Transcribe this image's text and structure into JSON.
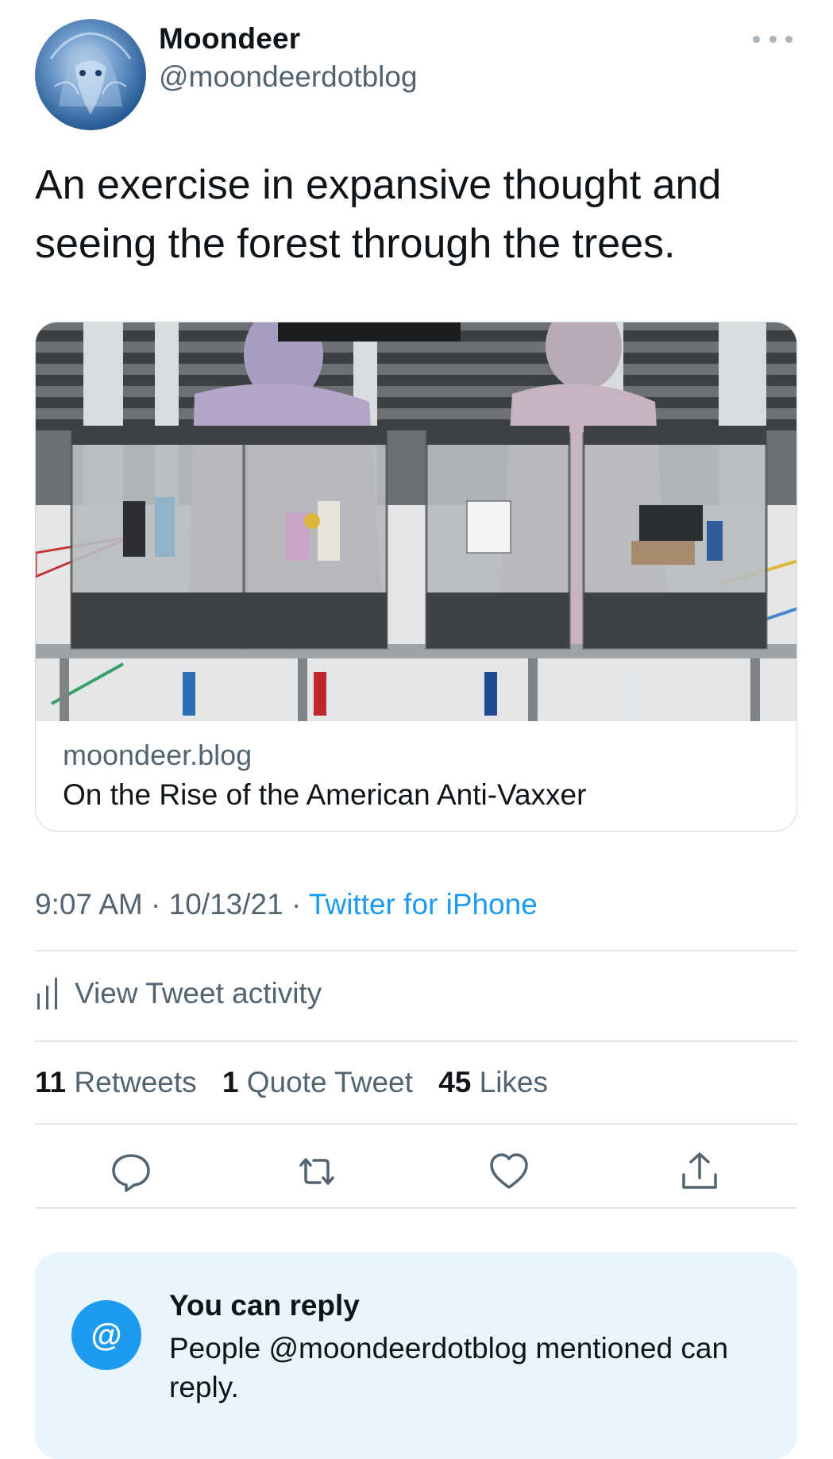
{
  "author": {
    "display_name": "Moondeer",
    "handle": "@moondeerdotblog"
  },
  "tweet": {
    "text": "An exercise in expansive thought and seeing the forest through the trees.",
    "time": "9:07 AM",
    "date": "10/13/21",
    "separator": "·",
    "source": "Twitter for iPhone"
  },
  "link_card": {
    "domain": "moondeer.blog",
    "title": "On the Rise of the American Anti-Vaxxer"
  },
  "activity": {
    "label": "View Tweet activity"
  },
  "stats": {
    "retweets_count": "11",
    "retweets_label": "Retweets",
    "quotes_count": "1",
    "quotes_label": "Quote Tweet",
    "likes_count": "45",
    "likes_label": "Likes"
  },
  "actions": [
    "reply-icon",
    "retweet-icon",
    "like-icon",
    "share-icon"
  ],
  "reply_notice": {
    "icon": "@",
    "title": "You can reply",
    "description": "People @moondeerdotblog mentioned can reply."
  },
  "colors": {
    "accent": "#1d9bf0",
    "secondary_text": "#536471",
    "notice_bg": "#e8f5fd"
  }
}
